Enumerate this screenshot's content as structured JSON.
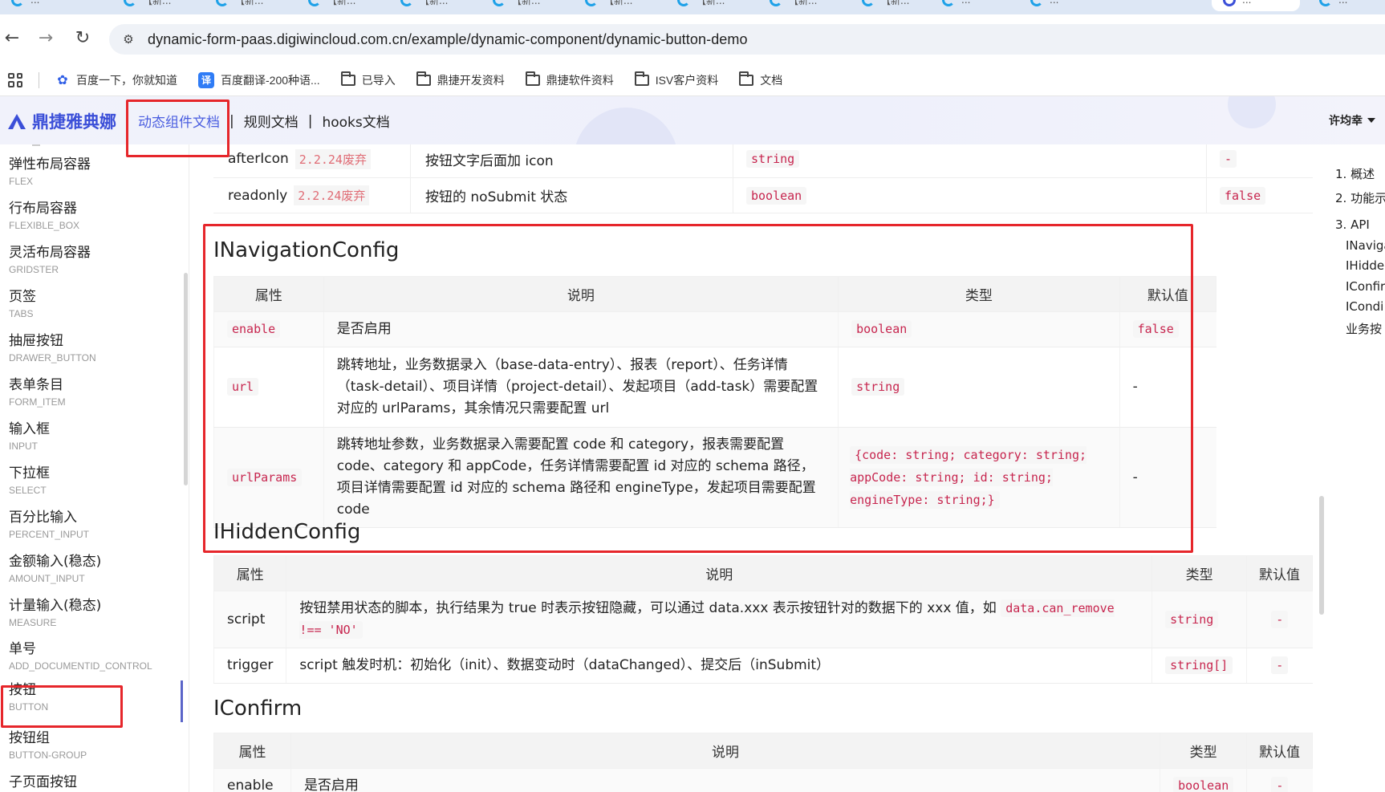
{
  "browser": {
    "tabs": [
      {
        "title": "..."
      },
      {
        "title": "【新..."
      },
      {
        "title": "【新..."
      },
      {
        "title": "【新..."
      },
      {
        "title": "【新..."
      },
      {
        "title": "【新..."
      },
      {
        "title": "【新..."
      },
      {
        "title": "【新..."
      },
      {
        "title": "【新..."
      },
      {
        "title": "【新..."
      },
      {
        "title": "..."
      },
      {
        "title": "..."
      },
      {
        "title": "..."
      },
      {
        "title": "..."
      }
    ],
    "url": "dynamic-form-paas.digiwincloud.com.cn/example/dynamic-component/dynamic-button-demo",
    "bookmarks": [
      {
        "label": "百度一下，你就知道",
        "icon": "baidu-icon"
      },
      {
        "label": "百度翻译-200种语...",
        "icon": "translate-icon",
        "icon_text": "译"
      },
      {
        "label": "已导入",
        "icon": "folder-icon"
      },
      {
        "label": "鼎捷开发资料",
        "icon": "folder-icon"
      },
      {
        "label": "鼎捷软件资料",
        "icon": "folder-icon"
      },
      {
        "label": "ISV客户资料",
        "icon": "folder-icon"
      },
      {
        "label": "文档",
        "icon": "folder-icon"
      }
    ]
  },
  "header": {
    "brand": "鼎捷雅典娜",
    "nav": [
      {
        "label": "动态组件文档",
        "active": true
      },
      {
        "label": "规则文档",
        "active": false
      },
      {
        "label": "hooks文档",
        "active": false
      }
    ],
    "separator": "|",
    "user": "许均幸"
  },
  "sidebar": {
    "items": [
      {
        "cn": "弹性布局容器",
        "en": "FLEX"
      },
      {
        "cn": "行布局容器",
        "en": "FLEXIBLE_BOX"
      },
      {
        "cn": "灵活布局容器",
        "en": "GRIDSTER"
      },
      {
        "cn": "页签",
        "en": "TABS"
      },
      {
        "cn": "抽屉按钮",
        "en": "DRAWER_BUTTON"
      },
      {
        "cn": "表单条目",
        "en": "FORM_ITEM"
      },
      {
        "cn": "输入框",
        "en": "INPUT"
      },
      {
        "cn": "下拉框",
        "en": "SELECT"
      },
      {
        "cn": "百分比输入",
        "en": "PERCENT_INPUT"
      },
      {
        "cn": "金额输入(稳态)",
        "en": "AMOUNT_INPUT"
      },
      {
        "cn": "计量输入(稳态)",
        "en": "MEASURE"
      },
      {
        "cn": "单号",
        "en": "ADD_DOCUMENTID_CONTROL"
      },
      {
        "cn": "按钮",
        "en": "BUTTON",
        "active": true
      },
      {
        "cn": "按钮组",
        "en": "BUTTON-GROUP"
      },
      {
        "cn": "子页面按钮",
        "en": ""
      }
    ]
  },
  "content": {
    "prev_rows": [
      {
        "name": "afterIcon",
        "tag": "2.2.24废弃",
        "desc": "按钮文字后面加 icon",
        "type": "string",
        "default": "-"
      },
      {
        "name": "readonly",
        "tag": "2.2.24废弃",
        "desc": "按钮的 noSubmit 状态",
        "type": "boolean",
        "default": "false"
      }
    ],
    "nav_config": {
      "title": "INavigationConfig",
      "headers": [
        "属性",
        "说明",
        "类型",
        "默认值"
      ],
      "rows": [
        {
          "name": "enable",
          "desc": "是否启用",
          "type": "boolean",
          "default": "false"
        },
        {
          "name": "url",
          "desc": "跳转地址，业务数据录入（base-data-entry）、报表（report）、任务详情（task-detail）、项目详情（project-detail）、发起项目（add-task）需要配置对应的 urlParams，其余情况只需要配置 url",
          "type": "string",
          "default": "-"
        },
        {
          "name": "urlParams",
          "desc": "跳转地址参数，业务数据录入需要配置 code 和 category，报表需要配置 code、category 和 appCode，任务详情需要配置 id 对应的 schema 路径，项目详情需要配置 id 对应的 schema 路径和 engineType，发起项目需要配置 code",
          "type": "{code: string; category: string; appCode: string; id: string; engineType: string;}",
          "default": "-"
        }
      ]
    },
    "hidden_config": {
      "title": "IHiddenConfig",
      "headers": [
        "属性",
        "说明",
        "类型",
        "默认值"
      ],
      "rows": [
        {
          "name": "script",
          "desc": "按钮禁用状态的脚本，执行结果为 true 时表示按钮隐藏，可以通过 data.xxx 表示按钮针对的数据下的 xxx 值，如",
          "code": "data.can_remove !== 'NO'",
          "type": "string",
          "default": "-"
        },
        {
          "name": "trigger",
          "desc": "script 触发时机：初始化（init）、数据变动时（dataChanged）、提交后（inSubmit）",
          "type": "string[]",
          "default": "-"
        }
      ]
    },
    "confirm": {
      "title": "IConfirm",
      "headers": [
        "属性",
        "说明",
        "类型",
        "默认值"
      ],
      "rows": [
        {
          "name": "enable",
          "desc": "是否启用",
          "type": "boolean",
          "default": "-"
        }
      ]
    }
  },
  "toc": {
    "items": [
      {
        "label": "1. 概述",
        "sub": false
      },
      {
        "label": "2. 功能示",
        "sub": false
      },
      {
        "label": "3. API",
        "sub": false
      },
      {
        "label": "INaviga",
        "sub": true
      },
      {
        "label": "IHidde",
        "sub": true
      },
      {
        "label": "IConfir",
        "sub": true
      },
      {
        "label": "ICondi",
        "sub": true
      },
      {
        "label": "业务按",
        "sub": true
      }
    ]
  },
  "colors": {
    "accent": "#4a5ee0",
    "highlight_box": "#e6262b",
    "code_text": "#c7254e"
  }
}
